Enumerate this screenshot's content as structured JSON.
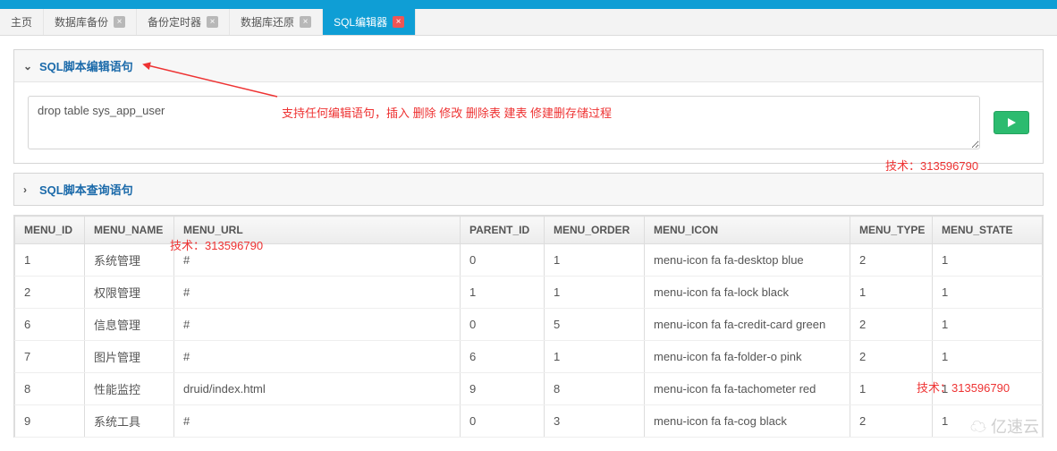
{
  "tabs": [
    {
      "label": "主页",
      "closable": false,
      "active": false
    },
    {
      "label": "数据库备份",
      "closable": true,
      "active": false
    },
    {
      "label": "备份定时器",
      "closable": true,
      "active": false
    },
    {
      "label": "数据库还原",
      "closable": true,
      "active": false
    },
    {
      "label": "SQL编辑器",
      "closable": true,
      "active": true
    }
  ],
  "panel_edit": {
    "title": "SQL脚本编辑语句",
    "sql_value": "drop table sys_app_user",
    "hint": "支持任何编辑语句，插入 删除  修改   删除表  建表  修建删存储过程"
  },
  "panel_query": {
    "title": "SQL脚本查询语句"
  },
  "watermarks": {
    "w1": "技术：313596790",
    "w2": "技术：313596790",
    "w3": "技术：313596790",
    "logo": "亿速云"
  },
  "table": {
    "headers": [
      "MENU_ID",
      "MENU_NAME",
      "MENU_URL",
      "PARENT_ID",
      "MENU_ORDER",
      "MENU_ICON",
      "MENU_TYPE",
      "MENU_STATE"
    ],
    "rows": [
      [
        "1",
        "系统管理",
        "#",
        "0",
        "1",
        "menu-icon fa fa-desktop blue",
        "2",
        "1"
      ],
      [
        "2",
        "权限管理",
        "#",
        "1",
        "1",
        "menu-icon fa fa-lock black",
        "1",
        "1"
      ],
      [
        "6",
        "信息管理",
        "#",
        "0",
        "5",
        "menu-icon fa fa-credit-card green",
        "2",
        "1"
      ],
      [
        "7",
        "图片管理",
        "#",
        "6",
        "1",
        "menu-icon fa fa-folder-o pink",
        "2",
        "1"
      ],
      [
        "8",
        "性能监控",
        "druid/index.html",
        "9",
        "8",
        "menu-icon fa fa-tachometer red",
        "1",
        "1"
      ],
      [
        "9",
        "系统工具",
        "#",
        "0",
        "3",
        "menu-icon fa fa-cog black",
        "2",
        "1"
      ]
    ],
    "col_widths": [
      "78px",
      "100px",
      "320px",
      "94px",
      "112px",
      "230px",
      "92px",
      "auto"
    ]
  }
}
